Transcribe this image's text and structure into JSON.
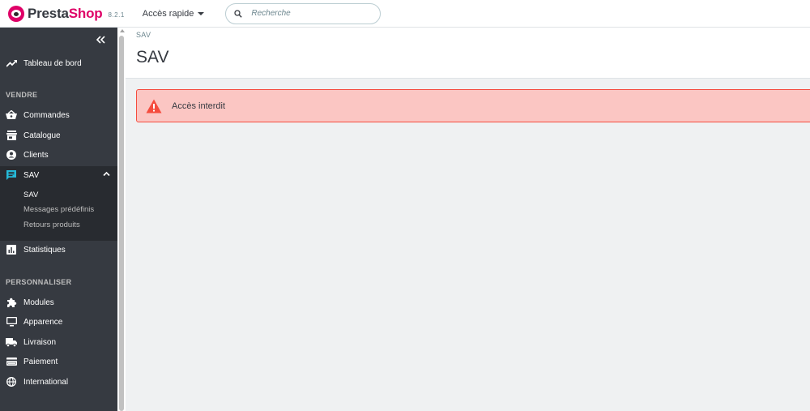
{
  "header": {
    "brand_first": "Presta",
    "brand_second": "Shop",
    "version": "8.2.1",
    "quick_access": "Accès rapide",
    "search_placeholder": "Recherche"
  },
  "sidebar": {
    "dashboard": "Tableau de bord",
    "section_sell": "VENDRE",
    "sell_items": {
      "orders": "Commandes",
      "catalog": "Catalogue",
      "customers": "Clients",
      "sav": "SAV"
    },
    "sav_sub": {
      "sav": "SAV",
      "predefined": "Messages prédéfinis",
      "returns": "Retours produits"
    },
    "stats": "Statistiques",
    "section_customize": "PERSONNALISER",
    "customize_items": {
      "modules": "Modules",
      "design": "Apparence",
      "shipping": "Livraison",
      "payment": "Paiement",
      "international": "International"
    }
  },
  "page": {
    "breadcrumb": "SAV",
    "title": "SAV"
  },
  "alert": {
    "message": "Accès interdit"
  },
  "colors": {
    "sidebar_bg": "#363a41",
    "sidebar_active_bg": "#282b30",
    "brand_pink": "#df0067",
    "accent_cyan": "#25b9d7",
    "alert_bg": "#fbc6c3",
    "alert_border": "#f54c3e",
    "danger_icon": "#f54c3e"
  },
  "icons": {
    "dashboard": "trending-up-icon",
    "orders": "shopping-basket-icon",
    "catalog": "store-icon",
    "customers": "account-circle-icon",
    "sav": "chat-icon",
    "stats": "bar-chart-icon",
    "modules": "puzzle-icon",
    "design": "desktop-icon",
    "shipping": "truck-icon",
    "payment": "credit-card-icon",
    "international": "globe-icon",
    "alert": "warning-icon"
  }
}
